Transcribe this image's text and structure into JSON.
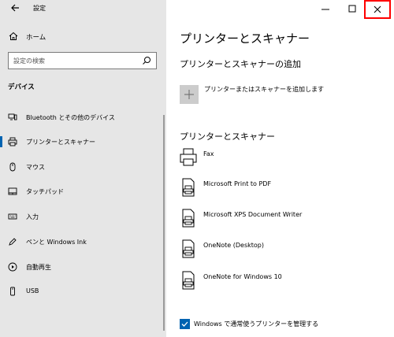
{
  "window": {
    "title": "設定"
  },
  "sidebar": {
    "home_label": "ホーム",
    "search_placeholder": "設定の検索",
    "section_label": "デバイス",
    "items": [
      {
        "label": "Bluetooth とその他のデバイス",
        "icon": "bluetooth-icon"
      },
      {
        "label": "プリンターとスキャナー",
        "icon": "printer-icon",
        "active": true
      },
      {
        "label": "マウス",
        "icon": "mouse-icon"
      },
      {
        "label": "タッチパッド",
        "icon": "touchpad-icon"
      },
      {
        "label": "入力",
        "icon": "keyboard-icon"
      },
      {
        "label": "ペンと Windows Ink",
        "icon": "pen-icon"
      },
      {
        "label": "自動再生",
        "icon": "autoplay-icon"
      },
      {
        "label": "USB",
        "icon": "usb-icon"
      }
    ]
  },
  "main": {
    "title": "プリンターとスキャナー",
    "add_section_title": "プリンターとスキャナーの追加",
    "add_label": "プリンターまたはスキャナーを追加します",
    "list_section_title": "プリンターとスキャナー",
    "printers": [
      {
        "name": "Fax",
        "icon": "fax-icon"
      },
      {
        "name": "Microsoft Print to PDF",
        "icon": "printer-doc-icon"
      },
      {
        "name": "Microsoft XPS Document Writer",
        "icon": "printer-doc-icon"
      },
      {
        "name": "OneNote (Desktop)",
        "icon": "printer-doc-icon"
      },
      {
        "name": "OneNote for Windows 10",
        "icon": "printer-doc-icon"
      }
    ],
    "checkbox_label": "Windows で通常使うプリンターを管理する",
    "checkbox_checked": true
  },
  "colors": {
    "accent": "#0063b1",
    "sidebar_bg": "#e6e6e6",
    "highlight": "#ff0000"
  }
}
